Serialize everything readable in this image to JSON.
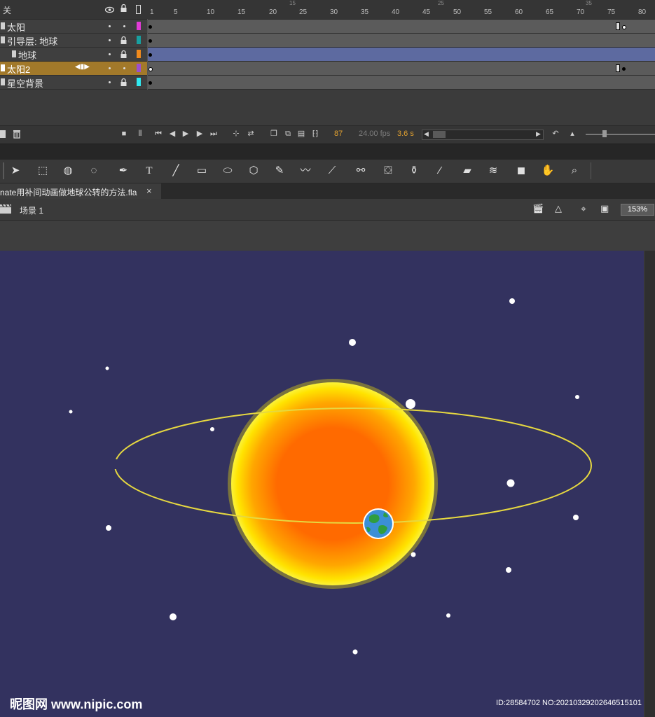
{
  "timeline": {
    "header_label": "关",
    "frame_numbers": [
      "1",
      "5",
      "10",
      "15",
      "20",
      "25",
      "30",
      "35",
      "40",
      "45",
      "50",
      "55",
      "60",
      "65",
      "70",
      "75",
      "80"
    ],
    "layers": [
      {
        "name": "太阳",
        "color": "#e23bd6"
      },
      {
        "name": "引导层: 地球",
        "color": "#18a0a0"
      },
      {
        "name": "地球",
        "color": "#f08a1c"
      },
      {
        "name": "太阳2",
        "color": "#9b4fd0"
      },
      {
        "name": "星空背景",
        "color": "#30e8f0"
      }
    ],
    "current_frame": "87",
    "fps": "24.00 fps",
    "time": "3.6 s"
  },
  "document": {
    "tab_title": "nate用补间动画做地球公转的方法.fla",
    "close_glyph": "×",
    "scene": "场景 1",
    "zoom": "153%"
  },
  "watermark": {
    "text": "昵图网 www.nipic.com",
    "id": "ID:28584702 NO:20210329202646515101"
  },
  "colors": {
    "stage": "#33325f",
    "orbit": "#e6d840",
    "sun_core": "#ff6a00",
    "sun_glow": "#ffee00",
    "selected_layer": "#a2792a",
    "tween_span": "#5d6aa0"
  },
  "icons": {
    "eye": "eye-icon",
    "lock": "lock-icon",
    "outline": "outline-icon"
  }
}
